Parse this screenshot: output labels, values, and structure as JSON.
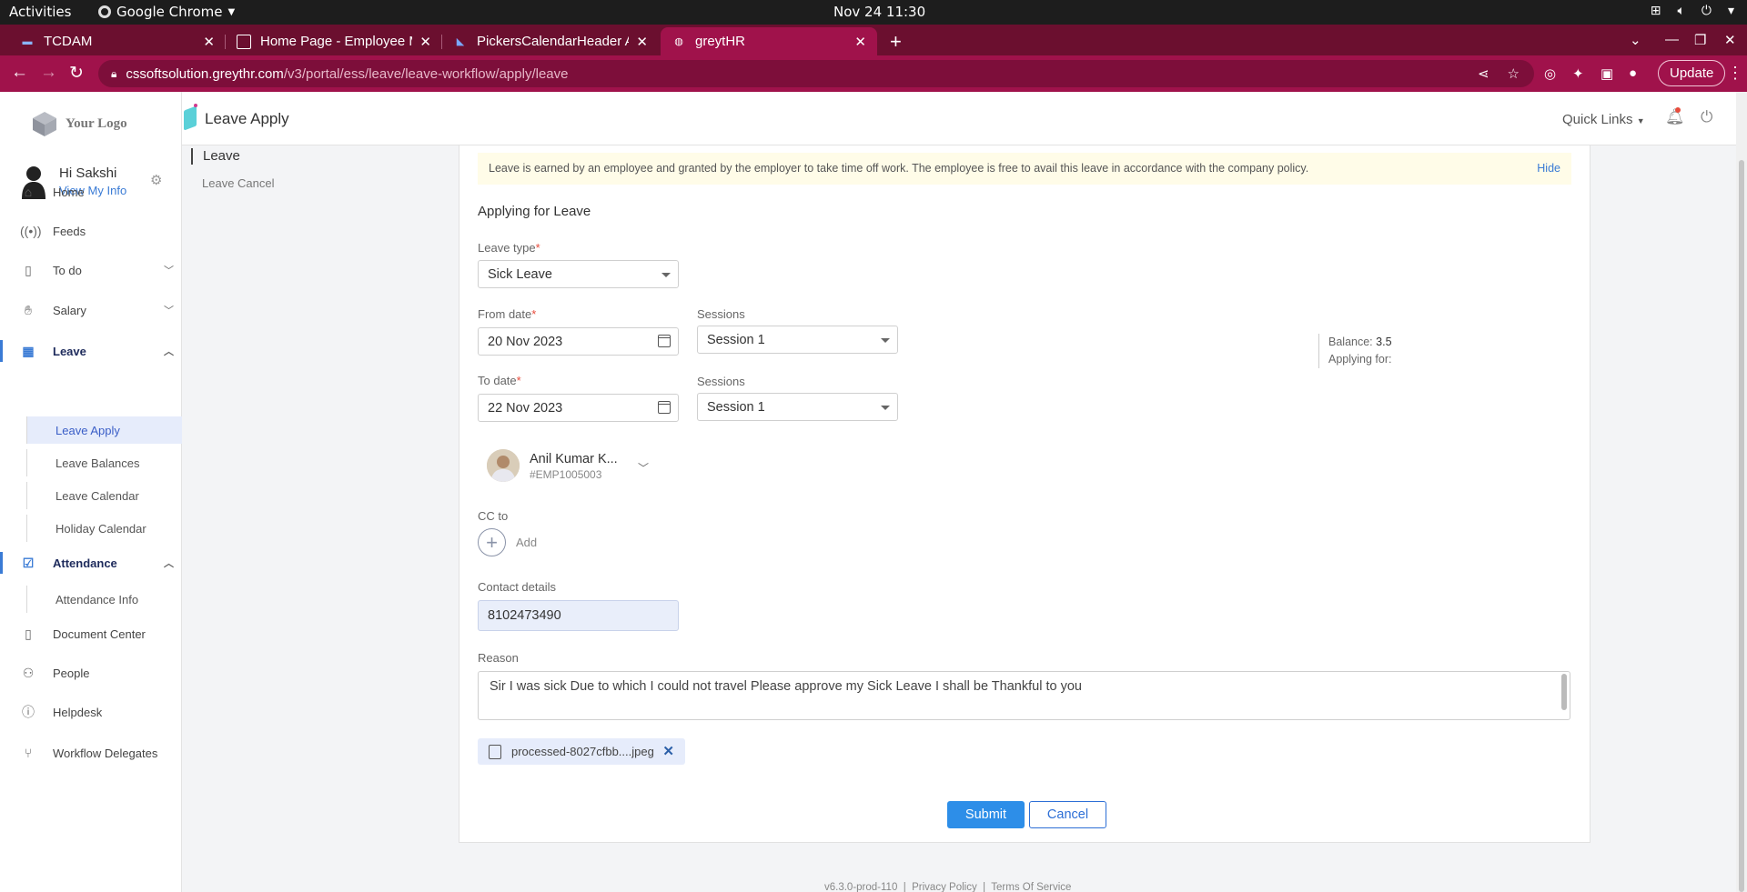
{
  "system": {
    "activities": "Activities",
    "app_name": "Google Chrome",
    "clock": "Nov 24  11:30"
  },
  "browser": {
    "tabs": [
      {
        "title": "TCDAM",
        "close": "✕"
      },
      {
        "title": "Home Page - Employee M",
        "close": "✕"
      },
      {
        "title": "PickersCalendarHeader A",
        "close": "✕"
      },
      {
        "title": "greytHR",
        "close": "✕"
      }
    ],
    "url_host": "cssoftsolution.greythr.com",
    "url_path": "/v3/portal/ess/leave/leave-workflow/apply/leave",
    "update_label": "Update"
  },
  "header": {
    "page_title": "Leave Apply",
    "quick_links": "Quick Links"
  },
  "sidebar": {
    "logo_text": "Your Logo",
    "greeting": "Hi Sakshi",
    "view_info": "View My Info",
    "items": [
      {
        "label": "Home",
        "icon": "home-icon"
      },
      {
        "label": "Feeds",
        "icon": "feeds-icon"
      },
      {
        "label": "To do",
        "icon": "clipboard-icon"
      },
      {
        "label": "Salary",
        "icon": "salary-icon"
      },
      {
        "label": "Leave",
        "icon": "calendar-icon"
      },
      {
        "label": "Attendance",
        "icon": "attendance-icon"
      },
      {
        "label": "Document Center",
        "icon": "book-icon"
      },
      {
        "label": "People",
        "icon": "people-icon"
      },
      {
        "label": "Helpdesk",
        "icon": "info-icon"
      },
      {
        "label": "Workflow Delegates",
        "icon": "workflow-icon"
      }
    ],
    "leave_sub": [
      "Leave Apply",
      "Leave Balances",
      "Leave Calendar",
      "Holiday Calendar"
    ],
    "attendance_sub": [
      "Attendance Info"
    ]
  },
  "sections": {
    "leave": "Leave",
    "leave_cancel": "Leave Cancel"
  },
  "form": {
    "notice": "Leave is earned by an employee and granted by the employer to take time off work. The employee is free to avail this leave in accordance with the company policy.",
    "hide_label": "Hide",
    "section_title": "Applying for Leave",
    "leave_type_label": "Leave type",
    "leave_type_value": "Sick Leave",
    "from_date_label": "From date",
    "from_date_value": "20 Nov 2023",
    "to_date_label": "To date",
    "to_date_value": "22 Nov 2023",
    "sessions_label": "Sessions",
    "from_session": "Session 1",
    "to_session": "Session 1",
    "balance_label": "Balance:",
    "balance_value": "3.5",
    "applying_for_label": "Applying for:",
    "approver_name": "Anil Kumar K...",
    "approver_code": "#EMP1005003",
    "cc_label": "CC to",
    "cc_add": "Add",
    "contact_label": "Contact details",
    "contact_value": "8102473490",
    "reason_label": "Reason",
    "reason_value": "Sir I was sick Due to which I could not travel Please approve my Sick Leave I shall be Thankful to you",
    "attachment_name": "processed-8027cfbb....jpeg",
    "submit_label": "Submit",
    "cancel_label": "Cancel"
  },
  "footer": {
    "version": "v6.3.0-prod-110",
    "privacy": "Privacy Policy",
    "terms": "Terms Of Service"
  },
  "colors": {
    "browser_chrome": "#a0124b",
    "tab_strip": "#6b0f2f",
    "primary": "#2d8ee8",
    "active_nav_bg": "#e6ecfb",
    "notice_bg": "#fffce8"
  }
}
